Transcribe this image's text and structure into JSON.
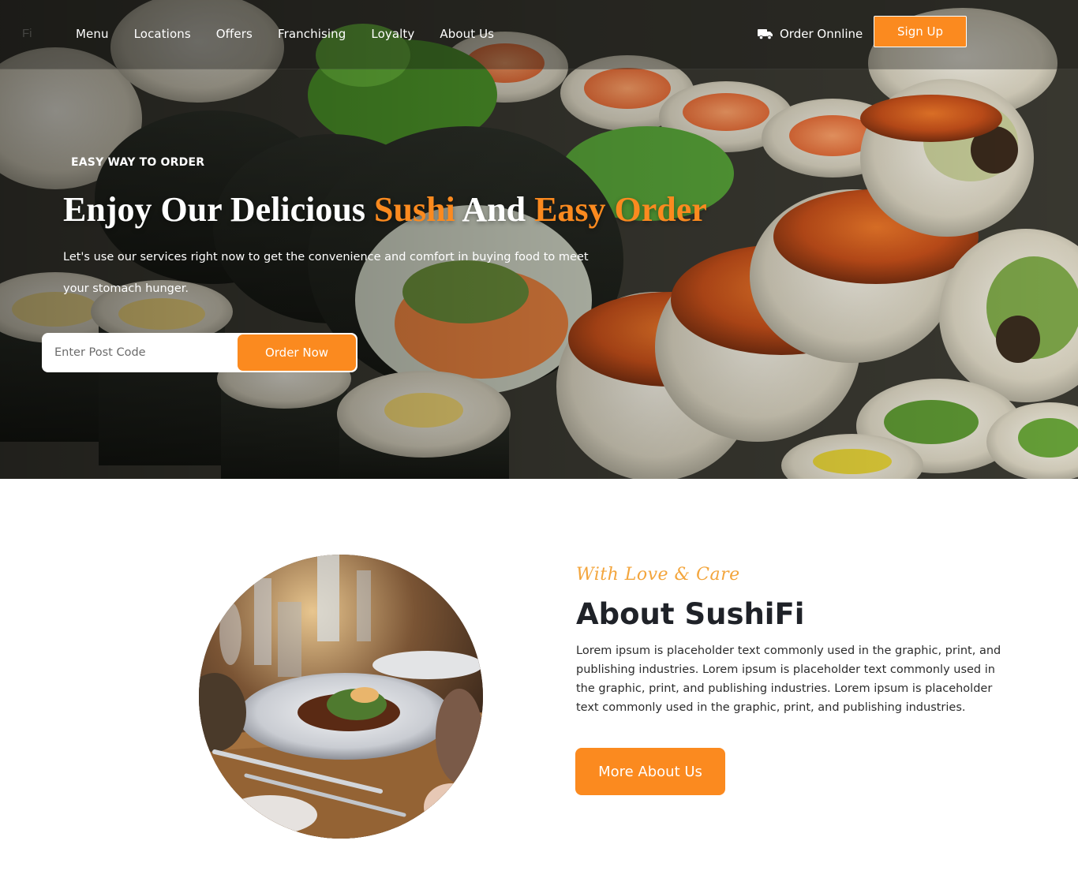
{
  "nav": {
    "logo": "Fi",
    "links": [
      "Menu",
      "Locations",
      "Offers",
      "Franchising",
      "Loyalty",
      "About Us"
    ],
    "order_online": "Order Onnline",
    "signup": "Sign Up"
  },
  "hero": {
    "eyebrow": "EASY WAY TO ORDER",
    "title_part1": "Enjoy Our Delicious ",
    "title_accent1": "Sushi",
    "title_part2": " And ",
    "title_accent2": "Easy Order",
    "description": "Let's use our services right now to get the convenience and comfort in buying food to meet your stomach hunger.",
    "postcode_placeholder": "Enter Post Code",
    "order_button": "Order Now"
  },
  "about": {
    "script": "With Love & Care",
    "title": "About SushiFi",
    "text": "Lorem ipsum is placeholder text commonly used in the graphic, print, and publishing industries. Lorem ipsum is placeholder text commonly used in the graphic, print, and publishing industries. Lorem ipsum is placeholder text commonly used in the graphic, print, and publishing industries.",
    "button": "More About Us"
  },
  "colors": {
    "accent": "#fb8a1f",
    "script": "#f3a53c",
    "heading": "#1f2228"
  },
  "icons": {
    "order_online": "truck-icon"
  }
}
